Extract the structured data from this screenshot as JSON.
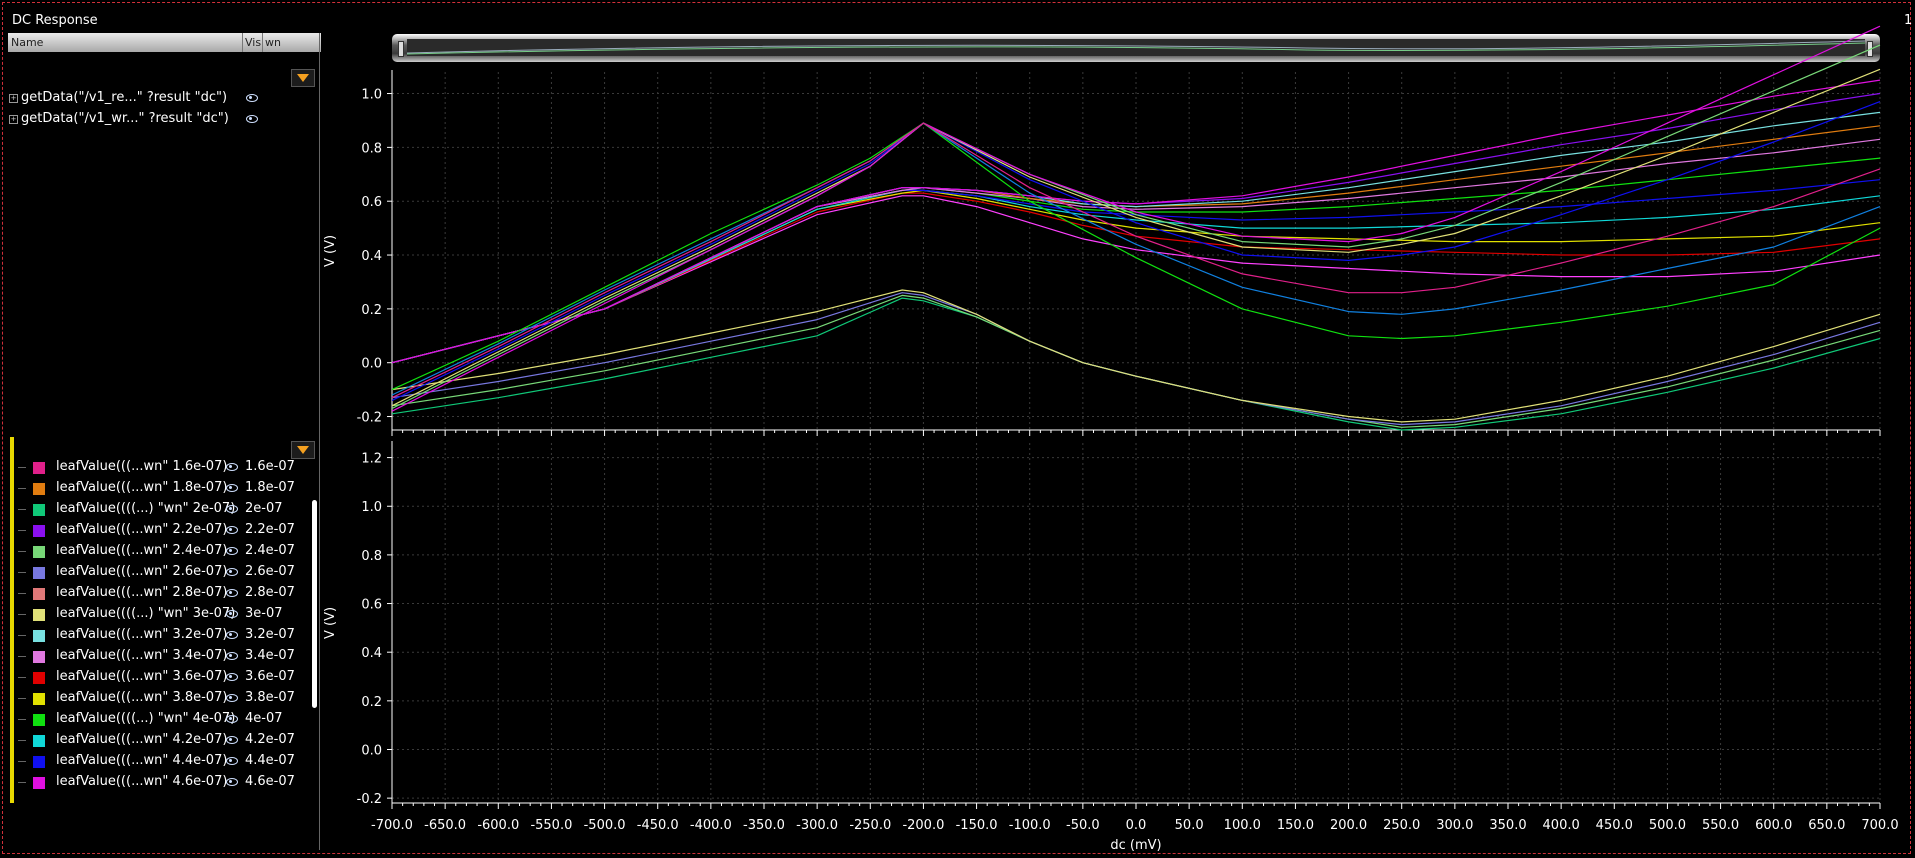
{
  "window": {
    "title": "DC Response",
    "page_num": "1"
  },
  "browser": {
    "columns": {
      "name": "Name",
      "vis": "Vis",
      "wn": "wn"
    },
    "traces": [
      {
        "label": "getData(\"/v1_re...\" ?result \"dc\")"
      },
      {
        "label": "getData(\"/v1_wr...\" ?result \"dc\")"
      }
    ]
  },
  "legend": [
    {
      "name": "leafValue(((...wn\" 1.6e-07)",
      "value": "1.6e-07",
      "color": "#e0208a"
    },
    {
      "name": "leafValue(((...wn\" 1.8e-07)",
      "value": "1.8e-07",
      "color": "#e07c10"
    },
    {
      "name": "leafValue((((...) \"wn\" 2e-07)",
      "value": "2e-07",
      "color": "#10c878"
    },
    {
      "name": "leafValue(((...wn\" 2.2e-07)",
      "value": "2.2e-07",
      "color": "#8a10f0"
    },
    {
      "name": "leafValue(((...wn\" 2.4e-07)",
      "value": "2.4e-07",
      "color": "#78d878"
    },
    {
      "name": "leafValue(((...wn\" 2.6e-07)",
      "value": "2.6e-07",
      "color": "#7878e0"
    },
    {
      "name": "leafValue(((...wn\" 2.8e-07)",
      "value": "2.8e-07",
      "color": "#e07878"
    },
    {
      "name": "leafValue((((...) \"wn\" 3e-07)",
      "value": "3e-07",
      "color": "#e0e078"
    },
    {
      "name": "leafValue(((...wn\" 3.2e-07)",
      "value": "3.2e-07",
      "color": "#78e0e0"
    },
    {
      "name": "leafValue(((...wn\" 3.4e-07)",
      "value": "3.4e-07",
      "color": "#e078e0"
    },
    {
      "name": "leafValue(((...wn\" 3.6e-07)",
      "value": "3.6e-07",
      "color": "#e00000"
    },
    {
      "name": "leafValue(((...wn\" 3.8e-07)",
      "value": "3.8e-07",
      "color": "#e0e000"
    },
    {
      "name": "leafValue((((...) \"wn\" 4e-07)",
      "value": "4e-07",
      "color": "#10e010"
    },
    {
      "name": "leafValue(((...wn\" 4.2e-07)",
      "value": "4.2e-07",
      "color": "#10d8d8"
    },
    {
      "name": "leafValue(((...wn\" 4.4e-07)",
      "value": "4.4e-07",
      "color": "#1010f0"
    },
    {
      "name": "leafValue(((...wn\" 4.6e-07)",
      "value": "4.6e-07",
      "color": "#e010e0"
    }
  ],
  "chart_data": [
    {
      "type": "line",
      "ylabel": "V (V)",
      "xlabel": "",
      "xlim": [
        -700,
        700
      ],
      "ylim": [
        -0.25,
        1.08
      ],
      "xticks": [
        -700,
        -650,
        -600,
        -550,
        -500,
        -450,
        -400,
        -350,
        -300,
        -250,
        -200,
        -150,
        -100,
        -50,
        0,
        50,
        100,
        150,
        200,
        250,
        300,
        350,
        400,
        450,
        500,
        550,
        600,
        650,
        700
      ],
      "yticks": [
        -0.2,
        0.0,
        0.2,
        0.4,
        0.6,
        0.8,
        1.0
      ],
      "grid": true,
      "series": [
        {
          "color": "#ff40ff",
          "x": [
            -700,
            -500,
            -300,
            -220,
            -200,
            -150,
            -100,
            -50,
            0,
            100,
            200,
            300,
            400,
            500,
            600,
            700
          ],
          "y": [
            0.0,
            0.2,
            0.55,
            0.62,
            0.62,
            0.58,
            0.52,
            0.46,
            0.42,
            0.37,
            0.35,
            0.33,
            0.32,
            0.32,
            0.34,
            0.4
          ]
        },
        {
          "color": "#e00000",
          "x": [
            -700,
            -500,
            -300,
            -220,
            -200,
            -150,
            -100,
            -50,
            0,
            100,
            200,
            300,
            400,
            500,
            600,
            700
          ],
          "y": [
            0.0,
            0.2,
            0.56,
            0.63,
            0.63,
            0.6,
            0.56,
            0.51,
            0.47,
            0.43,
            0.42,
            0.41,
            0.4,
            0.4,
            0.41,
            0.46
          ]
        },
        {
          "color": "#e0e000",
          "x": [
            -700,
            -500,
            -300,
            -220,
            -200,
            -150,
            -100,
            -50,
            0,
            100,
            200,
            300,
            400,
            500,
            600,
            700
          ],
          "y": [
            0.0,
            0.2,
            0.57,
            0.63,
            0.64,
            0.61,
            0.57,
            0.53,
            0.5,
            0.47,
            0.46,
            0.45,
            0.45,
            0.46,
            0.47,
            0.52
          ]
        },
        {
          "color": "#10d8d8",
          "x": [
            -700,
            -500,
            -300,
            -220,
            -200,
            -150,
            -100,
            -50,
            0,
            100,
            200,
            300,
            400,
            500,
            600,
            700
          ],
          "y": [
            0.0,
            0.2,
            0.57,
            0.64,
            0.64,
            0.62,
            0.58,
            0.55,
            0.53,
            0.5,
            0.5,
            0.51,
            0.52,
            0.54,
            0.57,
            0.62
          ]
        },
        {
          "color": "#1010f0",
          "x": [
            -700,
            -500,
            -300,
            -220,
            -200,
            -150,
            -100,
            -50,
            0,
            100,
            200,
            300,
            400,
            500,
            600,
            700
          ],
          "y": [
            0.0,
            0.2,
            0.58,
            0.64,
            0.64,
            0.62,
            0.59,
            0.56,
            0.55,
            0.53,
            0.54,
            0.56,
            0.58,
            0.61,
            0.64,
            0.68
          ]
        },
        {
          "color": "#10e010",
          "x": [
            -700,
            -500,
            -300,
            -220,
            -200,
            -150,
            -100,
            -50,
            0,
            100,
            200,
            300,
            400,
            500,
            600,
            700
          ],
          "y": [
            0.0,
            0.2,
            0.58,
            0.64,
            0.65,
            0.63,
            0.6,
            0.57,
            0.56,
            0.56,
            0.58,
            0.61,
            0.64,
            0.68,
            0.72,
            0.76
          ]
        },
        {
          "color": "#e078e0",
          "x": [
            -700,
            -500,
            -300,
            -220,
            -200,
            -150,
            -100,
            -50,
            0,
            100,
            200,
            300,
            400,
            500,
            600,
            700
          ],
          "y": [
            0.0,
            0.2,
            0.58,
            0.64,
            0.65,
            0.63,
            0.61,
            0.58,
            0.57,
            0.58,
            0.61,
            0.65,
            0.69,
            0.74,
            0.78,
            0.83
          ]
        },
        {
          "color": "#e07c10",
          "x": [
            -700,
            -500,
            -300,
            -220,
            -200,
            -150,
            -100,
            -50,
            0,
            100,
            200,
            300,
            400,
            500,
            600,
            700
          ],
          "y": [
            0.0,
            0.2,
            0.58,
            0.65,
            0.65,
            0.64,
            0.61,
            0.59,
            0.58,
            0.59,
            0.63,
            0.68,
            0.73,
            0.78,
            0.83,
            0.88
          ]
        },
        {
          "color": "#78e0e0",
          "x": [
            -700,
            -500,
            -300,
            -220,
            -200,
            -150,
            -100,
            -50,
            0,
            100,
            200,
            300,
            400,
            500,
            600,
            700
          ],
          "y": [
            0.0,
            0.2,
            0.58,
            0.65,
            0.65,
            0.64,
            0.62,
            0.59,
            0.58,
            0.6,
            0.65,
            0.71,
            0.77,
            0.82,
            0.88,
            0.93
          ]
        },
        {
          "color": "#8a10f0",
          "x": [
            -700,
            -500,
            -300,
            -220,
            -200,
            -150,
            -100,
            -50,
            0,
            100,
            200,
            300,
            400,
            500,
            600,
            700
          ],
          "y": [
            0.0,
            0.2,
            0.58,
            0.65,
            0.65,
            0.64,
            0.62,
            0.6,
            0.59,
            0.61,
            0.67,
            0.74,
            0.81,
            0.87,
            0.94,
            1.0
          ]
        },
        {
          "color": "#e010e0",
          "x": [
            -700,
            -500,
            -300,
            -220,
            -200,
            -150,
            -100,
            -50,
            0,
            100,
            200,
            300,
            400,
            500,
            600,
            700
          ],
          "y": [
            0.0,
            0.2,
            0.58,
            0.65,
            0.65,
            0.64,
            0.62,
            0.6,
            0.59,
            0.62,
            0.69,
            0.77,
            0.85,
            0.92,
            0.99,
            1.05
          ]
        },
        {
          "color": "#10c878",
          "x": [
            -700,
            -600,
            -500,
            -400,
            -300,
            -220,
            -200,
            -150,
            -100,
            -50,
            0,
            100,
            200,
            250,
            300,
            400,
            500,
            600,
            700
          ],
          "y": [
            -0.19,
            -0.13,
            -0.06,
            0.02,
            0.1,
            0.24,
            0.23,
            0.17,
            0.08,
            0.0,
            -0.05,
            -0.14,
            -0.22,
            -0.25,
            -0.24,
            -0.19,
            -0.11,
            -0.02,
            0.09
          ]
        },
        {
          "color": "#78d878",
          "x": [
            -700,
            -600,
            -500,
            -400,
            -300,
            -220,
            -200,
            -150,
            -100,
            -50,
            0,
            100,
            200,
            250,
            300,
            400,
            500,
            600,
            700
          ],
          "y": [
            -0.16,
            -0.1,
            -0.03,
            0.05,
            0.13,
            0.25,
            0.24,
            0.17,
            0.08,
            0.0,
            -0.05,
            -0.14,
            -0.21,
            -0.24,
            -0.23,
            -0.17,
            -0.09,
            0.01,
            0.12
          ]
        },
        {
          "color": "#7878e0",
          "x": [
            -700,
            -600,
            -500,
            -400,
            -300,
            -220,
            -200,
            -150,
            -100,
            -50,
            0,
            100,
            200,
            250,
            300,
            400,
            500,
            600,
            700
          ],
          "y": [
            -0.13,
            -0.07,
            0.0,
            0.08,
            0.16,
            0.26,
            0.25,
            0.18,
            0.08,
            0.0,
            -0.05,
            -0.14,
            -0.21,
            -0.23,
            -0.22,
            -0.16,
            -0.07,
            0.03,
            0.15
          ]
        },
        {
          "color": "#e0e078",
          "x": [
            -700,
            -600,
            -500,
            -400,
            -300,
            -220,
            -200,
            -150,
            -100,
            -50,
            0,
            100,
            200,
            250,
            300,
            400,
            500,
            600,
            700
          ],
          "y": [
            -0.1,
            -0.04,
            0.03,
            0.11,
            0.19,
            0.27,
            0.26,
            0.18,
            0.08,
            0.0,
            -0.05,
            -0.14,
            -0.2,
            -0.22,
            -0.21,
            -0.14,
            -0.05,
            0.06,
            0.18
          ]
        },
        {
          "color": "#1010f0",
          "x": [
            -700,
            -600,
            -500,
            -400,
            -300,
            -250,
            -200,
            -100,
            0,
            100,
            200,
            250,
            300,
            400,
            500,
            600,
            700
          ],
          "y": [
            -0.14,
            0.05,
            0.25,
            0.44,
            0.64,
            0.74,
            0.89,
            0.68,
            0.52,
            0.4,
            0.38,
            0.4,
            0.43,
            0.55,
            0.68,
            0.82,
            0.97
          ]
        },
        {
          "color": "#e0e078",
          "x": [
            -700,
            -600,
            -500,
            -400,
            -300,
            -250,
            -200,
            -100,
            0,
            100,
            200,
            250,
            300,
            400,
            500,
            600,
            700
          ],
          "y": [
            -0.16,
            0.04,
            0.24,
            0.43,
            0.63,
            0.73,
            0.89,
            0.69,
            0.54,
            0.43,
            0.41,
            0.44,
            0.48,
            0.62,
            0.77,
            0.93,
            1.09
          ]
        },
        {
          "color": "#78d878",
          "x": [
            -700,
            -600,
            -500,
            -400,
            -300,
            -250,
            -200,
            -100,
            0,
            100,
            200,
            250,
            300,
            400,
            500,
            600,
            700
          ],
          "y": [
            -0.17,
            0.03,
            0.23,
            0.42,
            0.62,
            0.73,
            0.89,
            0.7,
            0.55,
            0.45,
            0.43,
            0.46,
            0.51,
            0.67,
            0.84,
            1.01,
            1.18
          ]
        },
        {
          "color": "#e010e0",
          "x": [
            -700,
            -600,
            -500,
            -400,
            -300,
            -250,
            -200,
            -100,
            0,
            100,
            200,
            250,
            300,
            400,
            500,
            600,
            700
          ],
          "y": [
            -0.18,
            0.02,
            0.22,
            0.42,
            0.62,
            0.73,
            0.89,
            0.7,
            0.56,
            0.47,
            0.45,
            0.48,
            0.54,
            0.71,
            0.89,
            1.07,
            1.25
          ]
        },
        {
          "color": "#10e010",
          "x": [
            -700,
            -600,
            -500,
            -400,
            -300,
            -250,
            -200,
            -100,
            0,
            100,
            200,
            250,
            300,
            400,
            500,
            600,
            700
          ],
          "y": [
            -0.1,
            0.08,
            0.28,
            0.48,
            0.66,
            0.76,
            0.89,
            0.6,
            0.39,
            0.2,
            0.1,
            0.09,
            0.1,
            0.15,
            0.21,
            0.29,
            0.5
          ]
        },
        {
          "color": "#1080e0",
          "x": [
            -700,
            -600,
            -500,
            -400,
            -300,
            -250,
            -200,
            -100,
            0,
            100,
            200,
            250,
            300,
            400,
            500,
            600,
            700
          ],
          "y": [
            -0.12,
            0.07,
            0.27,
            0.46,
            0.65,
            0.75,
            0.89,
            0.63,
            0.44,
            0.28,
            0.19,
            0.18,
            0.2,
            0.27,
            0.35,
            0.43,
            0.58
          ]
        },
        {
          "color": "#e0208a",
          "x": [
            -700,
            -600,
            -500,
            -400,
            -300,
            -250,
            -200,
            -100,
            0,
            100,
            200,
            250,
            300,
            400,
            500,
            600,
            700
          ],
          "y": [
            -0.13,
            0.06,
            0.26,
            0.45,
            0.65,
            0.75,
            0.89,
            0.65,
            0.47,
            0.33,
            0.26,
            0.26,
            0.28,
            0.37,
            0.47,
            0.58,
            0.72
          ]
        }
      ]
    },
    {
      "type": "line",
      "ylabel": "V (V)",
      "xlabel": "dc (mV)",
      "xlim": [
        -700,
        700
      ],
      "ylim": [
        -0.22,
        1.26
      ],
      "xticks": [
        -700,
        -650,
        -600,
        -550,
        -500,
        -450,
        -400,
        -350,
        -300,
        -250,
        -200,
        -150,
        -100,
        -50,
        0,
        50,
        100,
        150,
        200,
        250,
        300,
        350,
        400,
        450,
        500,
        550,
        600,
        650,
        700
      ],
      "yticks": [
        -0.2,
        0.0,
        0.2,
        0.4,
        0.6,
        0.8,
        1.0,
        1.2
      ],
      "grid": true
    }
  ]
}
